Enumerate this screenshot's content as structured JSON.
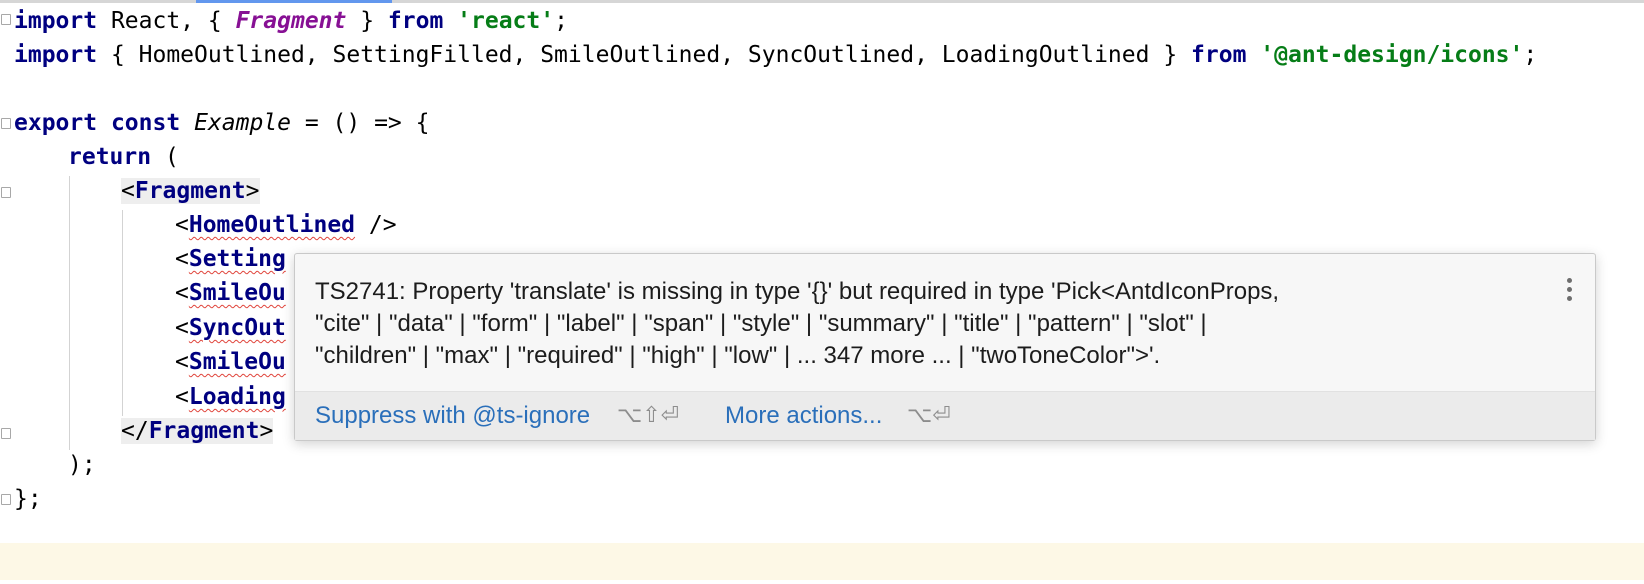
{
  "code": {
    "l1": {
      "import": "import",
      "react_brace": " React, { ",
      "fragment": "Fragment",
      "close": " } ",
      "from": "from",
      "space": " ",
      "module": "'react'",
      "semi": ";"
    },
    "l2": {
      "import": "import",
      "names": " { HomeOutlined, SettingFilled, SmileOutlined, SyncOutlined, LoadingOutlined } ",
      "from": "from",
      "space": " ",
      "module": "'@ant-design/icons'",
      "semi": ";"
    },
    "l4": {
      "export": "export",
      "sp1": " ",
      "const": "const",
      "sp2": " ",
      "name": "Example",
      "rest": " = () => {"
    },
    "l5": {
      "return": "return",
      "rest": " ("
    },
    "l6": {
      "open": "<",
      "tag": "Fragment",
      "close": ">"
    },
    "l7": {
      "open": "<",
      "tag": "HomeOutlined",
      "close": " />"
    },
    "l8": {
      "open": "<",
      "tag": "Setting"
    },
    "l9": {
      "open": "<",
      "tag": "SmileOu"
    },
    "l10": {
      "open": "<",
      "tag": "SyncOut"
    },
    "l11": {
      "open": "<",
      "tag": "SmileOu"
    },
    "l12": {
      "open": "<",
      "tag": "Loading"
    },
    "l13": {
      "open": "</",
      "tag": "Fragment",
      "close": ">"
    },
    "l14": {
      "text": ");"
    },
    "l15": {
      "text": "};"
    }
  },
  "popup": {
    "message_lines": [
      "TS2741: Property 'translate' is missing in type '{}' but required in type 'Pick<AntdIconProps,",
      "\"cite\" | \"data\" | \"form\" | \"label\" | \"span\" | \"style\" | \"summary\" | \"title\" | \"pattern\" | \"slot\" |",
      "\"children\" | \"max\" | \"required\" | \"high\" | \"low\" | ... 347 more ... | \"twoToneColor\">'."
    ],
    "actions": [
      {
        "label": "Suppress with @ts-ignore",
        "shortcut": "⌥⇧⏎"
      },
      {
        "label": "More actions...",
        "shortcut": "⌥⏎"
      }
    ]
  },
  "colors": {
    "keyword": "#000080",
    "string": "#067d17",
    "fragment_italic": "#871094",
    "error_underline": "#e0443b",
    "link": "#2a6fba",
    "current_line": "#fdf8e6"
  }
}
